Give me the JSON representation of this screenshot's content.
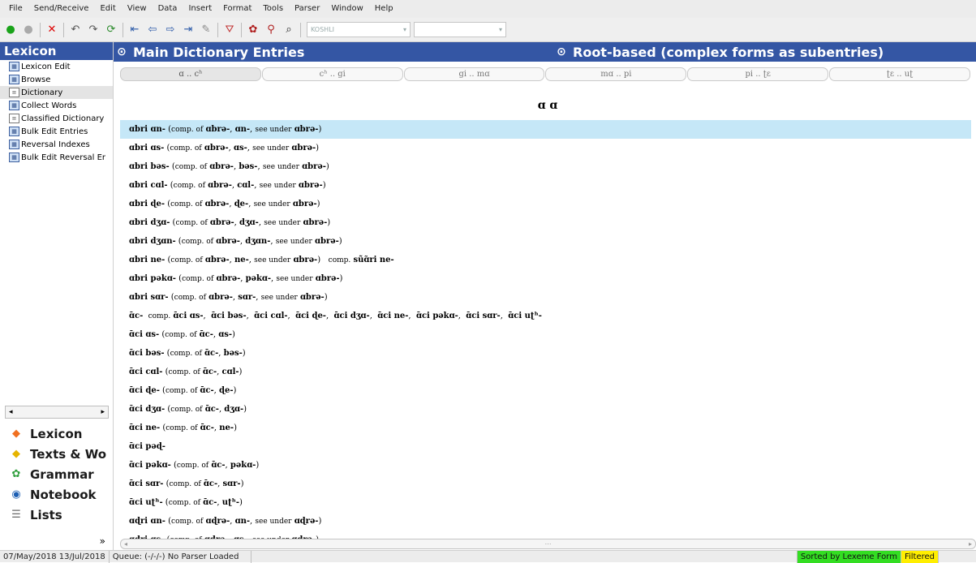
{
  "menubar": [
    "File",
    "Send/Receive",
    "Edit",
    "View",
    "Data",
    "Insert",
    "Format",
    "Tools",
    "Parser",
    "Window",
    "Help"
  ],
  "toolbar": {
    "icons": [
      "back-icon",
      "forward-icon",
      "delete-icon",
      "undo-icon",
      "redo-icon",
      "refresh-icon",
      "first-record-icon",
      "previous-record-icon",
      "next-record-icon",
      "last-record-icon",
      "edit-icon",
      "filter-icon",
      "find-icon",
      "find-lexicon-icon",
      "binoculars-icon"
    ],
    "writing_system_value": "KOSHLI",
    "style_value": ""
  },
  "leftpane": {
    "title": "Lexicon",
    "tools": [
      {
        "label": "Lexicon Edit",
        "selected": false
      },
      {
        "label": "Browse",
        "selected": false
      },
      {
        "label": "Dictionary",
        "selected": true
      },
      {
        "label": "Collect Words",
        "selected": false
      },
      {
        "label": "Classified Dictionary",
        "selected": false
      },
      {
        "label": "Bulk Edit Entries",
        "selected": false
      },
      {
        "label": "Reversal Indexes",
        "selected": false
      },
      {
        "label": "Bulk Edit Reversal Er",
        "selected": false
      }
    ],
    "areas": [
      {
        "label": "Lexicon",
        "icon": "lexicon-icon"
      },
      {
        "label": "Texts & Wo",
        "icon": "texts-icon"
      },
      {
        "label": "Grammar",
        "icon": "grammar-icon"
      },
      {
        "label": "Notebook",
        "icon": "notebook-icon"
      },
      {
        "label": "Lists",
        "icon": "lists-icon"
      }
    ],
    "more_glyph": "»"
  },
  "main": {
    "title": "Main Dictionary Entries",
    "right_title": "Root-based (complex forms as subentries)",
    "letter_tabs": [
      "ɑ .. cʰ",
      "cʰ .. gi",
      "gi .. mɑ",
      "mɑ .. pi",
      "pi .. ʈɛ",
      "ʈɛ .. uʈ"
    ],
    "letter_heading": "ɑ ɑ",
    "entries": [
      {
        "hw": "ɑbri ɑn-",
        "parts": [
          "ɑbrə-",
          "ɑn-"
        ],
        "see": "ɑbrə-",
        "selected": true
      },
      {
        "hw": "ɑbri ɑs-",
        "parts": [
          "ɑbrə-",
          "ɑs-"
        ],
        "see": "ɑbrə-"
      },
      {
        "hw": "ɑbri bəs-",
        "parts": [
          "ɑbrə-",
          "bəs-"
        ],
        "see": "ɑbrə-"
      },
      {
        "hw": "ɑbri cɑl-",
        "parts": [
          "ɑbrə-",
          "cɑl-"
        ],
        "see": "ɑbrə-"
      },
      {
        "hw": "ɑbri ɖe-",
        "parts": [
          "ɑbrə-",
          "ɖe-"
        ],
        "see": "ɑbrə-"
      },
      {
        "hw": "ɑbri dʒɑ-",
        "parts": [
          "ɑbrə-",
          "dʒɑ-"
        ],
        "see": "ɑbrə-"
      },
      {
        "hw": "ɑbri dʒɑn-",
        "parts": [
          "ɑbrə-",
          "dʒɑn-"
        ],
        "see": "ɑbrə-"
      },
      {
        "hw": "ɑbri ne-",
        "parts": [
          "ɑbrə-",
          "ne-"
        ],
        "see": "ɑbrə-",
        "extra": "sũɑ̃ri ne-"
      },
      {
        "hw": "ɑbri pəkɑ-",
        "parts": [
          "ɑbrə-",
          "pəkɑ-"
        ],
        "see": "ɑbrə-"
      },
      {
        "hw": "ɑbri sɑr-",
        "parts": [
          "ɑbrə-",
          "sɑr-"
        ],
        "see": "ɑbrə-"
      },
      {
        "hw": "ɑ̄c-",
        "comp_list": [
          "ɑ̄ci ɑs-",
          "ɑ̄ci bəs-",
          "ɑ̄ci cɑl-",
          "ɑ̄ci ɖe-",
          "ɑ̄ci dʒɑ-",
          "ɑ̄ci ne-",
          "ɑ̄ci pəkɑ-",
          "ɑ̄ci sɑr-",
          "ɑ̄ci uʈʰ-"
        ]
      },
      {
        "hw": "ɑ̄ci ɑs-",
        "parts": [
          "ɑ̄c-",
          "ɑs-"
        ]
      },
      {
        "hw": "ɑ̄ci bəs-",
        "parts": [
          "ɑ̄c-",
          "bəs-"
        ]
      },
      {
        "hw": "ɑ̄ci cɑl-",
        "parts": [
          "ɑ̄c-",
          "cɑl-"
        ]
      },
      {
        "hw": "ɑ̄ci ɖe-",
        "parts": [
          "ɑ̄c-",
          "ɖe-"
        ]
      },
      {
        "hw": "ɑ̄ci dʒɑ-",
        "parts": [
          "ɑ̄c-",
          "dʒɑ-"
        ]
      },
      {
        "hw": "ɑ̄ci ne-",
        "parts": [
          "ɑ̄c-",
          "ne-"
        ]
      },
      {
        "hw": "ɑ̄ci pəɖ-"
      },
      {
        "hw": "ɑ̄ci pəkɑ-",
        "parts": [
          "ɑ̄c-",
          "pəkɑ-"
        ]
      },
      {
        "hw": "ɑ̄ci sɑr-",
        "parts": [
          "ɑ̄c-",
          "sɑr-"
        ]
      },
      {
        "hw": "ɑ̄ci uʈʰ-",
        "parts": [
          "ɑ̄c-",
          "uʈʰ-"
        ]
      },
      {
        "hw": "ɑɖri ɑn-",
        "parts": [
          "ɑɖrə-",
          "ɑn-"
        ],
        "see": "ɑɖrə-"
      },
      {
        "hw": "ɑɖri ɑs-",
        "parts": [
          "ɑɖrə-",
          "ɑs-"
        ],
        "see": "ɑɖrə-"
      }
    ],
    "labels": {
      "comp_of": "comp. of",
      "see_under": "see under",
      "comp": "comp."
    }
  },
  "statusbar": {
    "dates": "07/May/2018 13/Jul/2018",
    "queue": "Queue: (-/-/-) No Parser Loaded",
    "sorted": "Sorted by Lexeme Form",
    "filtered": "Filtered"
  },
  "colors": {
    "header_blue": "#3456a4",
    "selected_row": "#c5e7f7",
    "sorted_green": "#33dd22",
    "filtered_yellow": "#ffee00"
  }
}
